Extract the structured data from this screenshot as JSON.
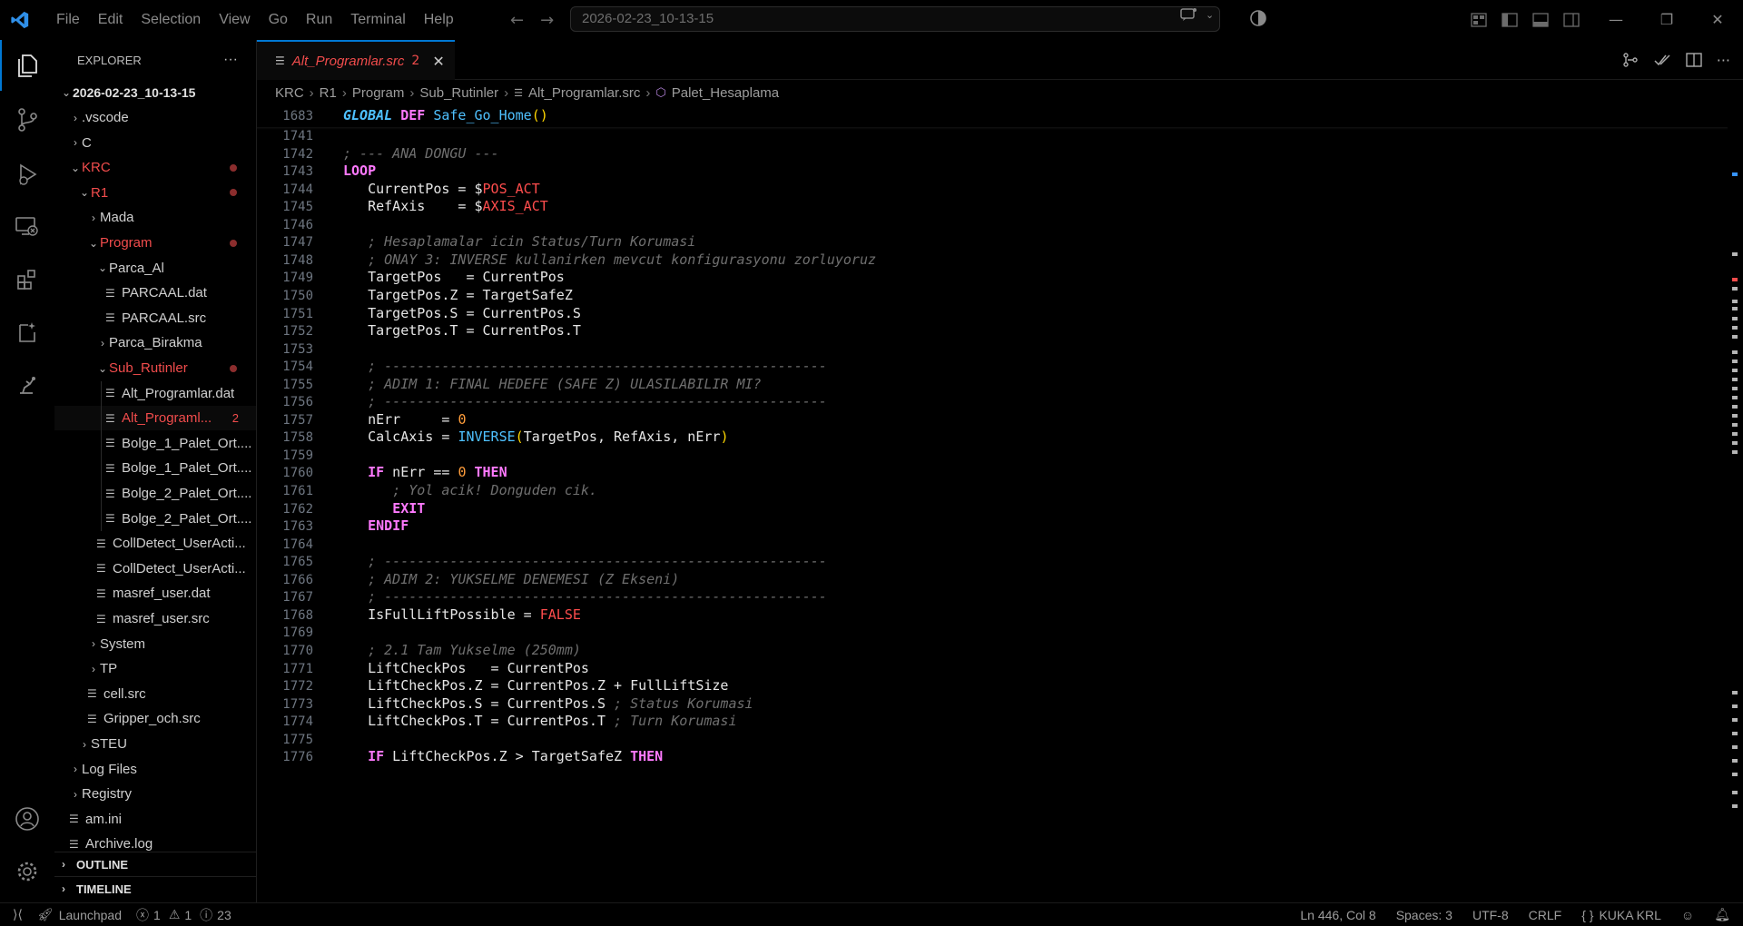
{
  "titlebar": {
    "menu": [
      "File",
      "Edit",
      "Selection",
      "View",
      "Go",
      "Run",
      "Terminal",
      "Help"
    ],
    "search": "2026-02-23_10-13-15",
    "back_icon": "arrow-left-icon",
    "forward_icon": "arrow-right-icon"
  },
  "sidebar": {
    "title": "EXPLORER",
    "more": "···",
    "root": "2026-02-23_10-13-15",
    "items": [
      {
        "label": ".vscode",
        "type": "folder",
        "open": false,
        "depth": 1
      },
      {
        "label": "C",
        "type": "folder",
        "open": false,
        "depth": 1
      },
      {
        "label": "KRC",
        "type": "folder",
        "open": true,
        "depth": 1,
        "modified": true
      },
      {
        "label": "R1",
        "type": "folder",
        "open": true,
        "depth": 2,
        "modified": true
      },
      {
        "label": "Mada",
        "type": "folder",
        "open": false,
        "depth": 3
      },
      {
        "label": "Program",
        "type": "folder",
        "open": true,
        "depth": 3,
        "modified": true
      },
      {
        "label": "Parca_Al",
        "type": "folder",
        "open": true,
        "depth": 4
      },
      {
        "label": "PARCAAL.dat",
        "type": "file",
        "depth": 5
      },
      {
        "label": "PARCAAL.src",
        "type": "file",
        "depth": 5
      },
      {
        "label": "Parca_Birakma",
        "type": "folder",
        "open": false,
        "depth": 4
      },
      {
        "label": "Sub_Rutinler",
        "type": "folder",
        "open": true,
        "depth": 4,
        "modified": true
      },
      {
        "label": "Alt_Programlar.dat",
        "type": "file",
        "depth": 5
      },
      {
        "label": "Alt_Programl...",
        "type": "file",
        "depth": 5,
        "modified": true,
        "badge": "2",
        "selected": true
      },
      {
        "label": "Bolge_1_Palet_Ort....",
        "type": "file",
        "depth": 5
      },
      {
        "label": "Bolge_1_Palet_Ort....",
        "type": "file",
        "depth": 5
      },
      {
        "label": "Bolge_2_Palet_Ort....",
        "type": "file",
        "depth": 5
      },
      {
        "label": "Bolge_2_Palet_Ort....",
        "type": "file",
        "depth": 5
      },
      {
        "label": "CollDetect_UserActi...",
        "type": "file",
        "depth": 4
      },
      {
        "label": "CollDetect_UserActi...",
        "type": "file",
        "depth": 4
      },
      {
        "label": "masref_user.dat",
        "type": "file",
        "depth": 4
      },
      {
        "label": "masref_user.src",
        "type": "file",
        "depth": 4
      },
      {
        "label": "System",
        "type": "folder",
        "open": false,
        "depth": 3
      },
      {
        "label": "TP",
        "type": "folder",
        "open": false,
        "depth": 3
      },
      {
        "label": "cell.src",
        "type": "file",
        "depth": 3
      },
      {
        "label": "Gripper_och.src",
        "type": "file",
        "depth": 3
      },
      {
        "label": "STEU",
        "type": "folder",
        "open": false,
        "depth": 2
      },
      {
        "label": "Log Files",
        "type": "folder",
        "open": false,
        "depth": 1
      },
      {
        "label": "Registry",
        "type": "folder",
        "open": false,
        "depth": 1
      },
      {
        "label": "am.ini",
        "type": "file",
        "depth": 1
      },
      {
        "label": "Archive.log",
        "type": "file",
        "depth": 1
      }
    ],
    "outline": "OUTLINE",
    "timeline": "TIMELINE"
  },
  "tab": {
    "label": "Alt_Programlar.src",
    "badge": "2",
    "close": "✕"
  },
  "breadcrumb": [
    "KRC",
    "R1",
    "Program",
    "Sub_Rutinler",
    "Alt_Programlar.src",
    "Palet_Hesaplama"
  ],
  "sticky": {
    "ln": "1683",
    "global": "GLOBAL",
    "def": "DEF",
    "name": "Safe_Go_Home",
    "parens": "()"
  },
  "lines": [
    {
      "n": "1741",
      "t": ""
    },
    {
      "n": "1742",
      "t": "; --- ANA DONGU ---"
    },
    {
      "n": "1743",
      "t": "LOOP"
    },
    {
      "n": "1744",
      "t": "   CurrentPos = $POS_ACT"
    },
    {
      "n": "1745",
      "t": "   RefAxis    = $AXIS_ACT"
    },
    {
      "n": "1746",
      "t": ""
    },
    {
      "n": "1747",
      "t": "   ; Hesaplamalar icin Status/Turn Korumasi"
    },
    {
      "n": "1748",
      "t": "   ; ONAY 3: INVERSE kullanirken mevcut konfigurasyonu zorluyoruz"
    },
    {
      "n": "1749",
      "t": "   TargetPos   = CurrentPos"
    },
    {
      "n": "1750",
      "t": "   TargetPos.Z = TargetSafeZ"
    },
    {
      "n": "1751",
      "t": "   TargetPos.S = CurrentPos.S"
    },
    {
      "n": "1752",
      "t": "   TargetPos.T = CurrentPos.T"
    },
    {
      "n": "1753",
      "t": ""
    },
    {
      "n": "1754",
      "t": "   ; ------------------------------------------------------"
    },
    {
      "n": "1755",
      "t": "   ; ADIM 1: FINAL HEDEFE (SAFE Z) ULASILABILIR MI?"
    },
    {
      "n": "1756",
      "t": "   ; ------------------------------------------------------"
    },
    {
      "n": "1757",
      "t": "   nErr     = 0"
    },
    {
      "n": "1758",
      "t": "   CalcAxis = INVERSE(TargetPos, RefAxis, nErr)"
    },
    {
      "n": "1759",
      "t": ""
    },
    {
      "n": "1760",
      "t": "   IF nErr == 0 THEN"
    },
    {
      "n": "1761",
      "t": "      ; Yol acik! Donguden cik."
    },
    {
      "n": "1762",
      "t": "      EXIT"
    },
    {
      "n": "1763",
      "t": "   ENDIF"
    },
    {
      "n": "1764",
      "t": ""
    },
    {
      "n": "1765",
      "t": "   ; ------------------------------------------------------"
    },
    {
      "n": "1766",
      "t": "   ; ADIM 2: YUKSELME DENEMESI (Z Ekseni)"
    },
    {
      "n": "1767",
      "t": "   ; ------------------------------------------------------"
    },
    {
      "n": "1768",
      "t": "   IsFullLiftPossible = FALSE"
    },
    {
      "n": "1769",
      "t": ""
    },
    {
      "n": "1770",
      "t": "   ; 2.1 Tam Yukselme (250mm)"
    },
    {
      "n": "1771",
      "t": "   LiftCheckPos   = CurrentPos"
    },
    {
      "n": "1772",
      "t": "   LiftCheckPos.Z = CurrentPos.Z + FullLiftSize"
    },
    {
      "n": "1773",
      "t": "   LiftCheckPos.S = CurrentPos.S ; Status Korumasi"
    },
    {
      "n": "1774",
      "t": "   LiftCheckPos.T = CurrentPos.T ; Turn Korumasi"
    },
    {
      "n": "1775",
      "t": ""
    },
    {
      "n": "1776",
      "t": "   IF LiftCheckPos.Z > TargetSafeZ THEN"
    }
  ],
  "status": {
    "launchpad": "Launchpad",
    "errors": "1",
    "warnings": "1",
    "info": "23",
    "position": "Ln 446, Col 8",
    "spaces": "Spaces: 3",
    "encoding": "UTF-8",
    "eol": "CRLF",
    "language": "KUKA KRL"
  }
}
